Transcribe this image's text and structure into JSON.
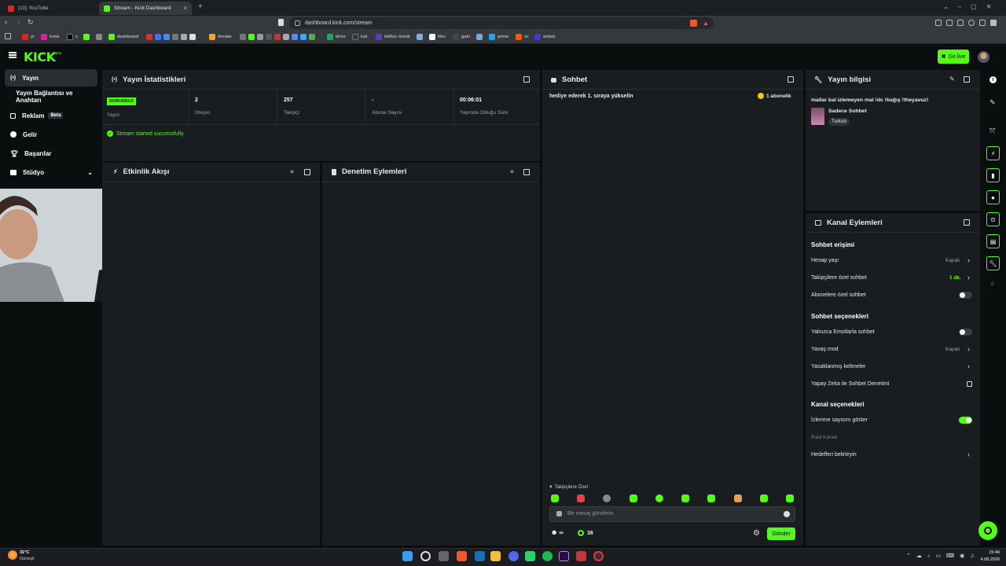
{
  "browser": {
    "tabs": [
      {
        "label": "(10) YouTube"
      },
      {
        "label": "Stream - Kick Dashboard"
      }
    ],
    "new_tab": "+",
    "url": "dashboard.kick.com/stream",
    "bookmarks": [
      "yt",
      "insta",
      "x",
      "dashboard",
      "donate",
      "drive",
      "tod",
      "telifsiz müzik",
      "hbo",
      "gain",
      "prime",
      "sc",
      "artists"
    ]
  },
  "app": {
    "logo": "KICK",
    "logo_sup": "BETA",
    "go_live": "Go live"
  },
  "sidebar": {
    "items": [
      {
        "label": "Yayın",
        "icon": "broadcast-icon"
      },
      {
        "label": "Yayın Bağlantısı ve Anahtarı",
        "icon": ""
      },
      {
        "label": "Reklam",
        "icon": "ad-icon",
        "badge": "Beta"
      },
      {
        "label": "Gelir",
        "icon": "dollar-icon"
      },
      {
        "label": "Başarılar",
        "icon": "trophy-icon"
      },
      {
        "label": "Stüdyo",
        "icon": "studio-icon"
      }
    ]
  },
  "stats": {
    "title": "Yayın İstatistikleri",
    "status_badge": "SORUNSUZ",
    "cells": [
      {
        "value": "",
        "label": "Yayın"
      },
      {
        "value": "2",
        "label": "İzleyici"
      },
      {
        "value": "257",
        "label": "Takipçi"
      },
      {
        "value": "-",
        "label": "Abone Sayısı"
      },
      {
        "value": "00:06:01",
        "label": "Yayında Olduğu Süre"
      }
    ],
    "message": "Stream started successfully."
  },
  "activity": {
    "title": "Etkinlik Akışı"
  },
  "moderation": {
    "title": "Denetim Eylemleri"
  },
  "chat": {
    "title": "Sohbet",
    "pinned": "hediye ederek 1. sıraya yükselin",
    "pinned_badge": "1 abonelik",
    "followers_only": "Takipçilere Özel",
    "input_placeholder": "Bir mesaj gönderin",
    "count_infinity": "∞",
    "points": "36",
    "send_label": "Gönder"
  },
  "stream_info": {
    "title": "Yayın bilgisi",
    "stream_title": "mallar bal izlemeyen mal !dc !bağış !theyavuz!",
    "mode": "Sadece Sohbet",
    "language": "Turkish"
  },
  "channel_actions": {
    "title": "Kanal Eylemleri",
    "chat_access_title": "Sohbet erişimi",
    "account_age": "Hesap yaşı",
    "account_age_value": "Kapalı",
    "followers_chat": "Takipçilere özel sohbet",
    "followers_chat_value": "1 dk.",
    "subs_chat": "Abonelere özel sohbet",
    "chat_options_title": "Sohbet seçenekleri",
    "emote_only": "Yalnızca Emotlarla sohbet",
    "slow_mode": "Yavaş mod",
    "slow_mode_value": "Kapalı",
    "banned_words": "Yasaklanmış kelimeler",
    "ai_moderation": "Yapay Zeka ile Sohbet Denetimi",
    "channel_options_title": "Kanal seçenekleri",
    "show_viewers": "İzlenme sayısını göster",
    "raid_channel": "Raid Kanalı",
    "set_goals": "Hedefleri belirleyin"
  },
  "taskbar": {
    "weather_temp": "31°C",
    "weather_text": "Güneşli",
    "time": "15:46",
    "date": "4.08.2026"
  },
  "colors": {
    "accent": "#53fc18",
    "panel": "#1a1d1f",
    "bg": "#0b0e0f"
  }
}
